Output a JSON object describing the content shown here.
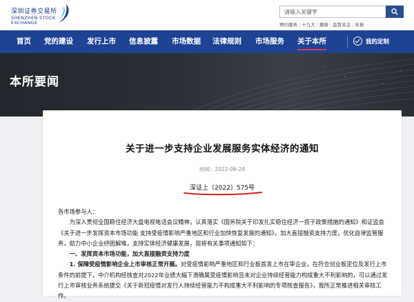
{
  "header": {
    "logo_cn": "深圳证券交易所",
    "logo_en": "SHENZHEN STOCK EXCHANGE",
    "search_placeholder": "请输入关键字",
    "hot_words": [
      "预约服务",
      "十九大",
      "播报",
      "监管关注",
      "年报"
    ]
  },
  "nav": {
    "items": [
      "首页",
      "党的建设",
      "发行上市",
      "信息披露",
      "市场数据",
      "法律规则",
      "市场服务",
      "关于本所"
    ],
    "active": "关于本所",
    "custom_label": "我的定制"
  },
  "banner": {
    "title": "本所要闻"
  },
  "article": {
    "title": "关于进一步支持企业发展服务实体经济的通知",
    "date": "时间：2022-06-24",
    "doc_number": "深证上〔2022〕575号",
    "salutation": "各市场参与人：",
    "intro": "为深入贯彻全国稳住经济大盘电视电话会议精神，认真落实《国务院关于印发扎实稳住经济一揽子政策措施的通知》和证监会《关于进一步发挥资本市场功能 支持受疫情影响严重地区和行业加快恢复发展的通知》，加大直接融资支持力度，优化自律监管服务，助力中小企业纾困解难，支持实体经济健康发展，现将有关事项通知如下：",
    "section1": "一、发挥资本市场功能，加大直接融资支持力度",
    "item1_lead": "1. 保障受疫情影响企业上市审核正常开展。",
    "item1_text": "对受疫情影响严重地区和行业板首发上市在审企业，在符合创业板定位及发行上市条件的前提下，中介机构经核查对2022年业绩大幅下滑确属受疫情影响且未对企业持续经营能力构成重大不利影响的，可以通过发行上市审核业务系统提交《关于新冠疫情对发行人持续经营能力不构成重大不利影响的专项核查报告》，我所正常推进相关审核工作。"
  }
}
